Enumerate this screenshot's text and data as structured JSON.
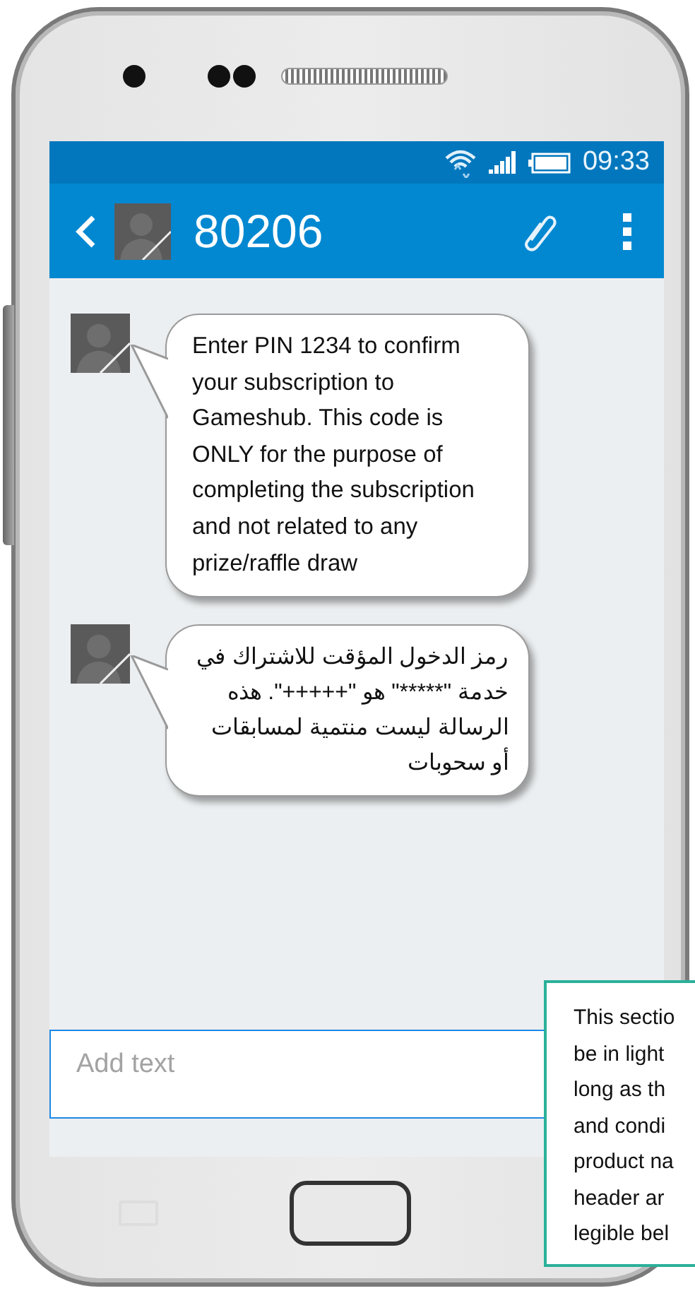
{
  "status_bar": {
    "time": "09:33"
  },
  "header": {
    "title": "80206"
  },
  "messages": [
    {
      "kind": "latin",
      "text": "Enter PIN 1234 to confirm your subscription to Gameshub. This code is ONLY for the purpose of completing the subscription and not related to any prize/raffle draw"
    },
    {
      "kind": "arabic",
      "text": "رمز الدخول المؤقت للاشتراك في خدمة \"*****\" هو \"+++++\". هذه الرسالة ليست منتمية لمسابقات أو سحوبات"
    }
  ],
  "composer": {
    "placeholder": "Add text"
  },
  "annotation": {
    "lines": [
      "This sectio",
      "be in light",
      "long as th",
      "and condi",
      "product na",
      "header ar",
      "legible bel"
    ]
  }
}
